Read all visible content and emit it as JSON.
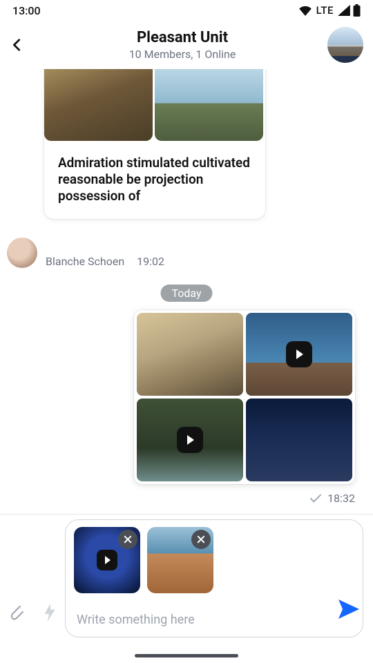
{
  "status": {
    "time": "13:00",
    "network": "LTE"
  },
  "header": {
    "title": "Pleasant Unit",
    "subtitle": "10 Members, 1 Online"
  },
  "messages": {
    "m1": {
      "caption": "Admiration stimulated cultivated reasonable be projection possession of",
      "sender": "Blanche Schoen",
      "time": "19:02"
    },
    "divider": "Today",
    "m2": {
      "time": "18:32"
    }
  },
  "composer": {
    "placeholder": "Write something here"
  }
}
